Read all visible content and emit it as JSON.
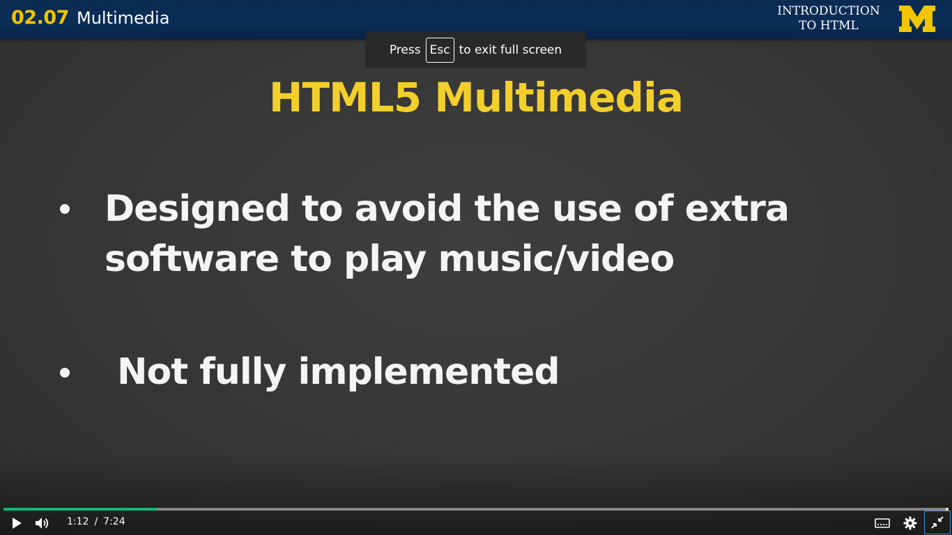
{
  "banner": {
    "lesson_number": "02.07",
    "lesson_title": "Multimedia",
    "course_line1": "INTRODUCTION",
    "course_line2": "TO HTML",
    "logo_icon": "block-m-logo-icon",
    "colors": {
      "navy": "#0b2d57",
      "maize": "#f2c500"
    }
  },
  "fullscreen_toast": {
    "prefix": "Press",
    "key": "Esc",
    "suffix": "to exit full screen"
  },
  "slide": {
    "title": "HTML5 Multimedia",
    "bullets": [
      {
        "line1": "Designed to avoid the use of extra",
        "line2": "software to play music/video"
      },
      {
        "line1": "Not fully implemented"
      }
    ],
    "colors": {
      "title": "#f2cf2b",
      "text": "#f4f4f4",
      "background": "#363636"
    }
  },
  "controls": {
    "current_time": "1:12",
    "separator": "/",
    "duration": "7:24",
    "progress_fraction": 0.162,
    "progress_color": "#1fae7a",
    "icons": {
      "play": "play-icon",
      "volume": "volume-icon",
      "captions": "captions-icon",
      "settings": "gear-icon",
      "exit_fullscreen": "exit-fullscreen-icon"
    }
  }
}
